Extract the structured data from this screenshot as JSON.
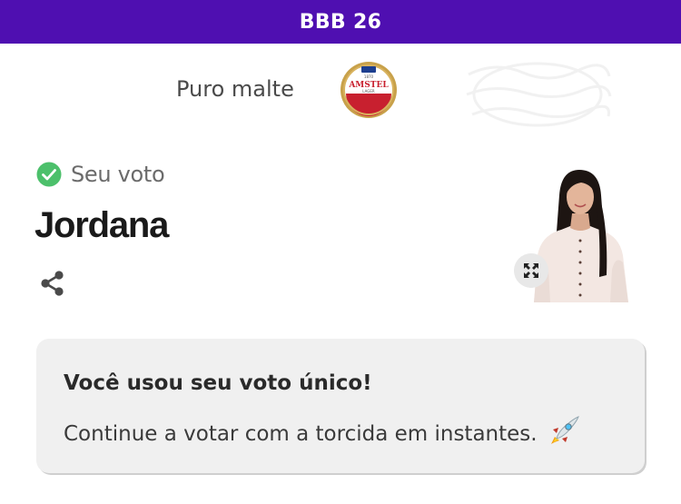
{
  "header": {
    "title": "BBB 26",
    "background_color": "#4f0fb1"
  },
  "sponsor": {
    "text": "Puro malte",
    "logo": {
      "icon": "amstel-logo",
      "top_text": "1870",
      "brand": "AMSTEL",
      "sub_text": "LAGER"
    },
    "secondary_logo": "faded-watermark-logo"
  },
  "vote": {
    "label": "Seu voto",
    "check_icon": "check-circle-icon",
    "check_color": "#4cc06b",
    "candidate_name": "Jordana",
    "share_icon": "share-icon",
    "expand_icon": "expand-icon",
    "photo": "candidate-photo"
  },
  "notice": {
    "title": "Você usou seu voto único!",
    "message": "Continue a votar com a torcida em instantes.",
    "emoji_icon": "rocket-icon"
  }
}
